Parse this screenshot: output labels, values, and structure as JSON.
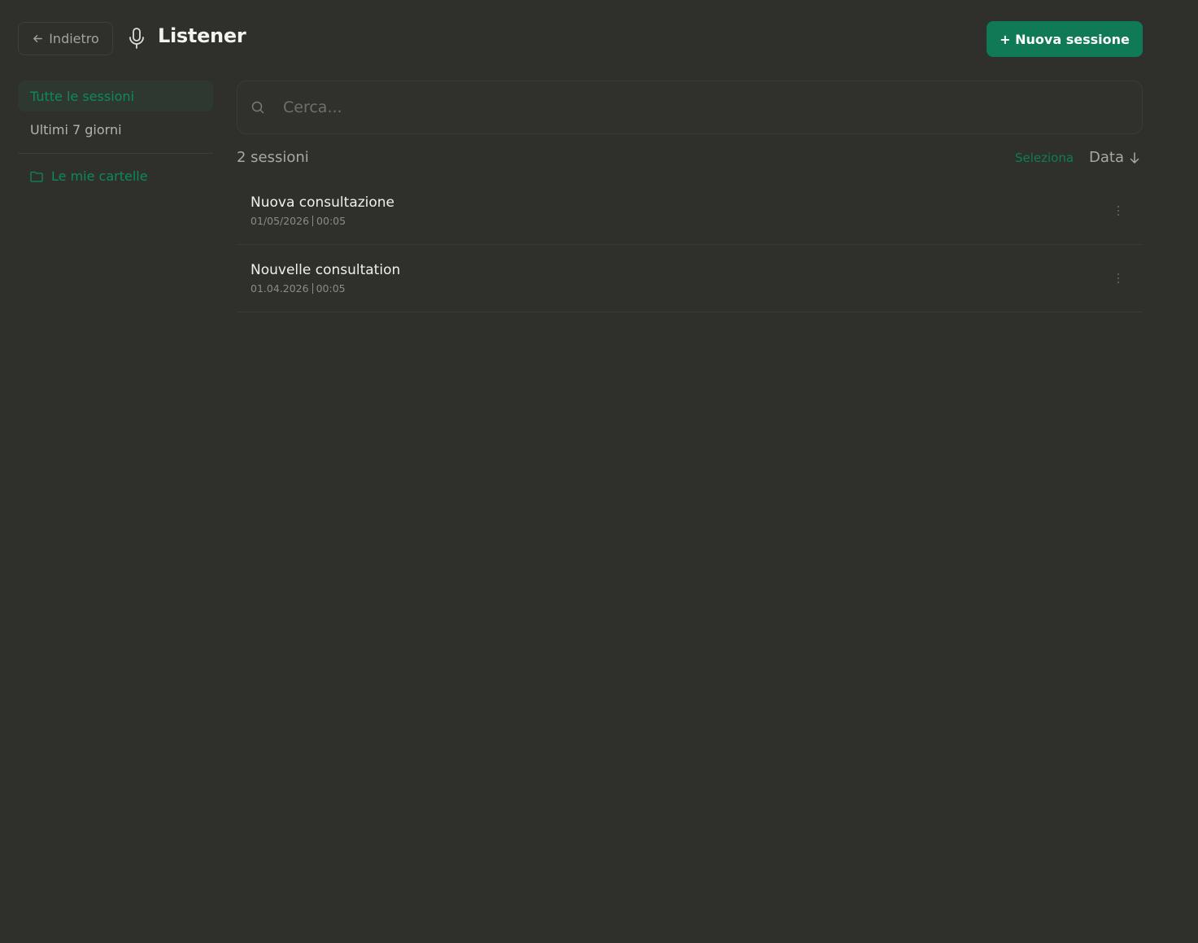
{
  "header": {
    "back_label": "Indietro",
    "app_title": "Listener",
    "new_session_label": "+ Nuova sessione"
  },
  "sidebar": {
    "items": [
      {
        "label": "Tutte le sessioni",
        "active": true
      },
      {
        "label": "Ultimi 7 giorni",
        "active": false
      }
    ],
    "folders_label": "Le mie cartelle"
  },
  "search": {
    "placeholder": "Cerca...",
    "value": ""
  },
  "list": {
    "count_label": "2 sessioni",
    "select_label": "Seleziona",
    "sort_label": "Data",
    "sessions": [
      {
        "title": "Nuova consultazione",
        "date": "01/05/2026",
        "duration": "00:05"
      },
      {
        "title": "Nouvelle consultation",
        "date": "01.04.2026",
        "duration": "00:05"
      }
    ]
  },
  "colors": {
    "background": "#2f2f2b",
    "accent": "#0f7a55",
    "accent_text": "#0c8a5c"
  },
  "icons": {
    "back": "arrow-left-icon",
    "app": "microphone-icon",
    "folder": "folder-icon",
    "search": "search-icon",
    "sort": "arrow-down-icon",
    "row_menu": "more-vertical-icon"
  }
}
